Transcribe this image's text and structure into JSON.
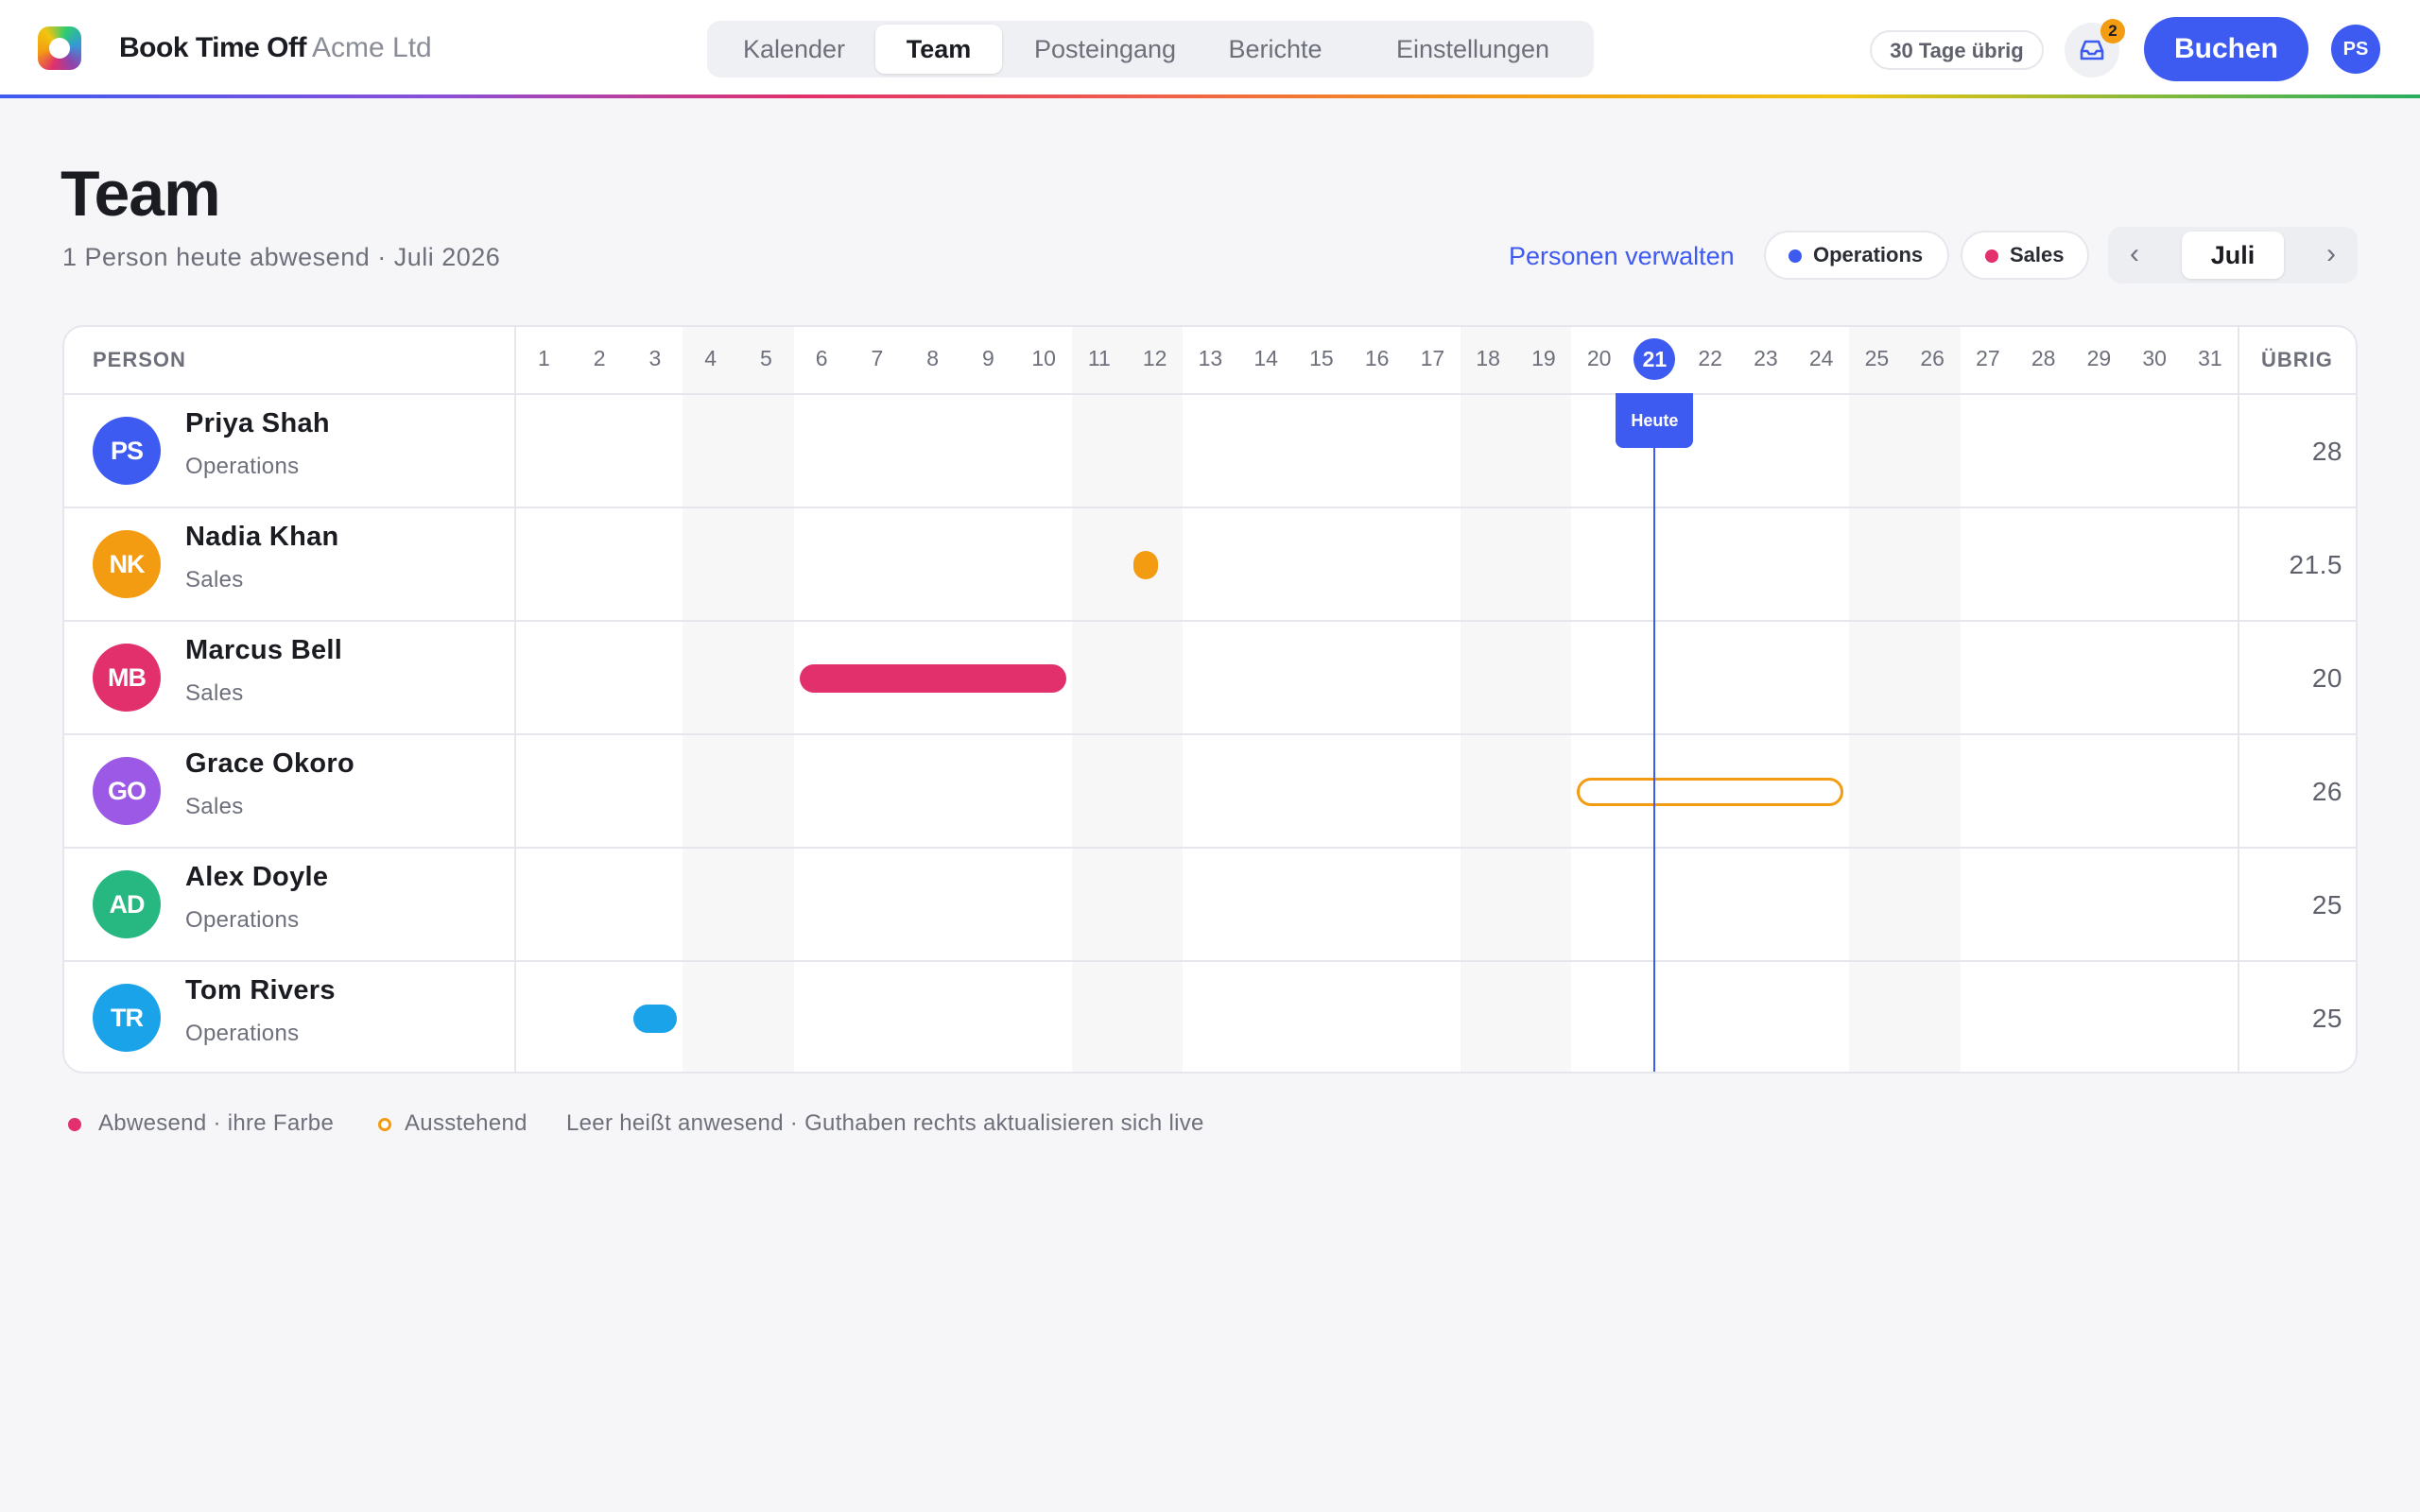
{
  "header": {
    "brand": "Book Time Off",
    "company": "Acme Ltd",
    "tabs": [
      {
        "label": "Kalender",
        "active": false
      },
      {
        "label": "Team",
        "active": true
      },
      {
        "label": "Posteingang",
        "active": false
      },
      {
        "label": "Berichte",
        "active": false
      },
      {
        "label": "Einstellungen",
        "active": false
      }
    ],
    "days_remaining": "30 Tage übrig",
    "inbox_count": "2",
    "book_label": "Buchen",
    "user_initials": "PS"
  },
  "page": {
    "title": "Team",
    "subtitle": "1 Person heute abwesend · Juli 2026",
    "manage_link": "Personen verwalten",
    "filters": [
      {
        "label": "Operations",
        "color": "#3d5af1"
      },
      {
        "label": "Sales",
        "color": "#e1306c"
      }
    ],
    "month": {
      "prev": "‹",
      "current": "Juli",
      "next": "›"
    }
  },
  "grid": {
    "person_header": "PERSON",
    "left_header": "ÜBRIG",
    "days": [
      1,
      2,
      3,
      4,
      5,
      6,
      7,
      8,
      9,
      10,
      11,
      12,
      13,
      14,
      15,
      16,
      17,
      18,
      19,
      20,
      21,
      22,
      23,
      24,
      25,
      26,
      27,
      28,
      29,
      30,
      31
    ],
    "weekend_days": [
      4,
      5,
      11,
      12,
      18,
      19,
      25,
      26
    ],
    "today": 21,
    "today_label": "Heute",
    "people": [
      {
        "initials": "PS",
        "name": "Priya Shah",
        "team": "Operations",
        "color": "#3d5af1",
        "left": "28",
        "absences": []
      },
      {
        "initials": "NK",
        "name": "Nadia Khan",
        "team": "Sales",
        "color": "#f39c12",
        "left": "21.5",
        "absences": [
          {
            "start": 12,
            "end": 12,
            "half": true,
            "status": "approved"
          }
        ]
      },
      {
        "initials": "MB",
        "name": "Marcus Bell",
        "team": "Sales",
        "color": "#e1306c",
        "left": "20",
        "absences": [
          {
            "start": 6,
            "end": 10,
            "status": "approved"
          }
        ]
      },
      {
        "initials": "GO",
        "name": "Grace Okoro",
        "team": "Sales",
        "color": "#9b59e6",
        "left": "26",
        "absences": [
          {
            "start": 20,
            "end": 24,
            "status": "pending"
          }
        ]
      },
      {
        "initials": "AD",
        "name": "Alex Doyle",
        "team": "Operations",
        "color": "#27b882",
        "left": "25",
        "absences": []
      },
      {
        "initials": "TR",
        "name": "Tom Rivers",
        "team": "Operations",
        "color": "#1aa3e8",
        "left": "25",
        "absences": [
          {
            "start": 3,
            "end": 3,
            "status": "approved"
          }
        ]
      }
    ]
  },
  "legend": {
    "absent": "Abwesend · ihre Farbe",
    "absent_color": "#e1306c",
    "pending": "Ausstehend",
    "pending_color": "#f39c12",
    "note": "Leer heißt anwesend · Guthaben rechts aktualisieren sich live"
  }
}
